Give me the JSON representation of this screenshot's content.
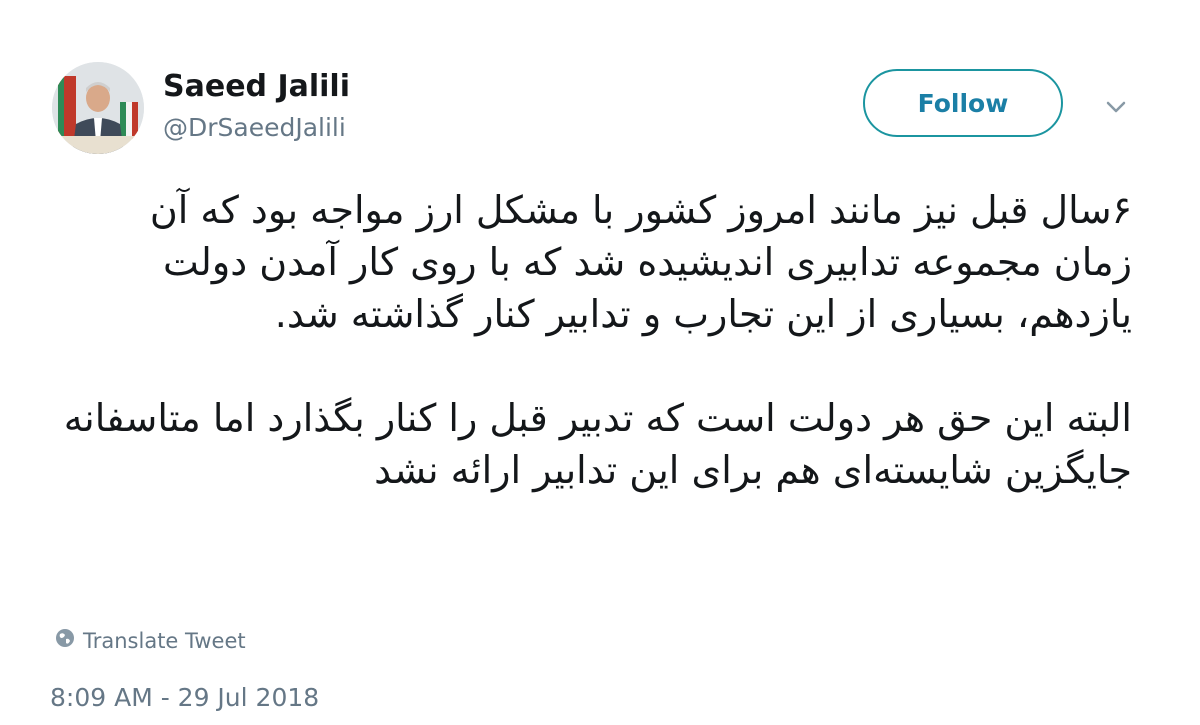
{
  "author": {
    "display_name": "Saeed Jalili",
    "handle": "@DrSaeedJalili",
    "avatar_icon": "profile-photo"
  },
  "actions": {
    "follow_label": "Follow",
    "caret_icon": "chevron-down-icon"
  },
  "tweet": {
    "paragraphs": [
      "۶سال قبل نیز مانند امروز کشور با مشکل ارز مواجه بود که آن زمان مجموعه تدابیری اندیشیده شد که با روی کار آمدن دولت یازدهم، بسیاری از این تجارب و تدابیر کنار گذاشته شد.",
      "البته این حق هر دولت است که تدبیر قبل را کنار بگذارد اما متاسفانه جایگزین شایسته‌ای هم برای این تدابیر ارائه نشد"
    ]
  },
  "translate": {
    "label": "Translate Tweet",
    "icon": "globe-icon"
  },
  "timestamp": "8:09 AM - 29 Jul 2018",
  "colors": {
    "follow_accent": "#1b95a0",
    "muted_text": "#657786",
    "primary_text": "#14171a"
  }
}
